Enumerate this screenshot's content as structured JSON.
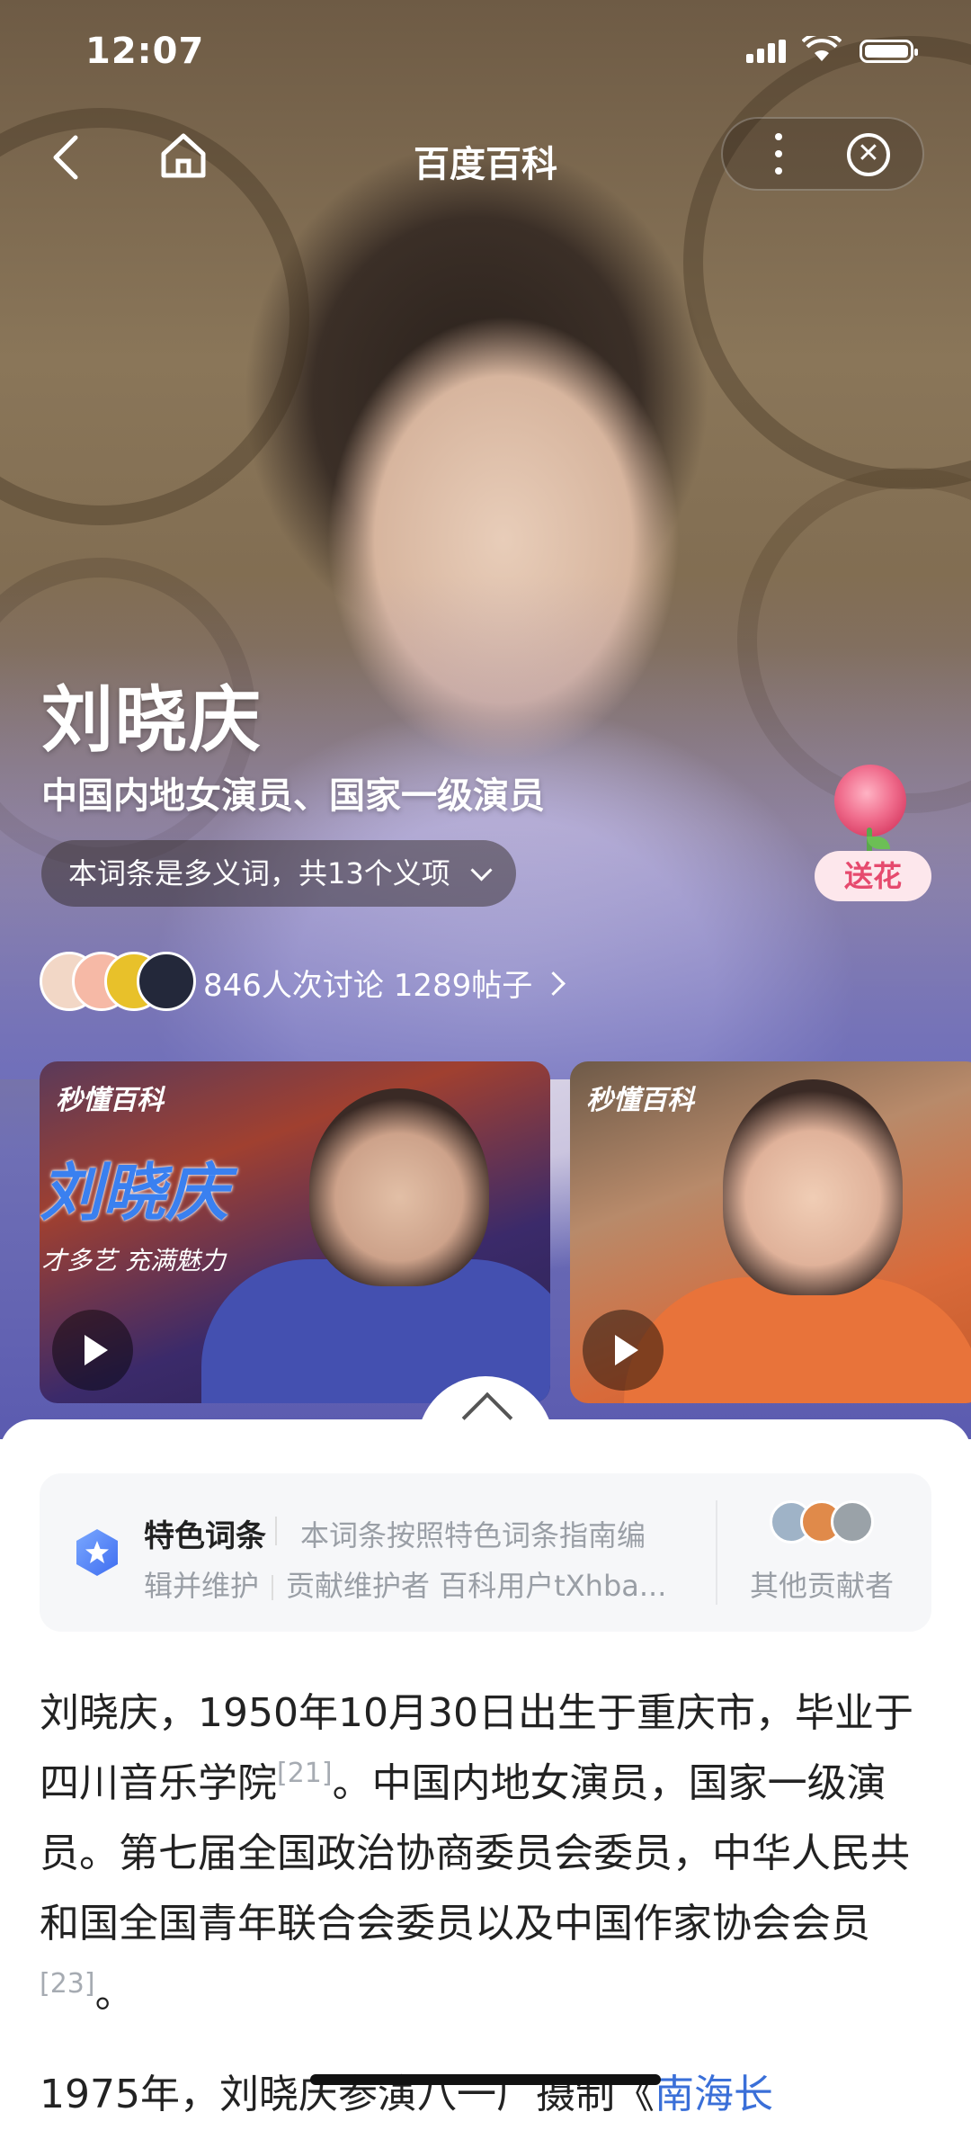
{
  "status_bar": {
    "time": "12:07"
  },
  "nav": {
    "title": "百度百科"
  },
  "person": {
    "name": "刘晓庆",
    "description": "中国内地女演员、国家一级演员",
    "polysemy_label": "本词条是多义词，共13个义项"
  },
  "flower": {
    "label": "送花"
  },
  "discussion": {
    "text": "846人次讨论  1289帖子"
  },
  "videos": [
    {
      "brand": "秒懂百科",
      "headline": "刘晓庆",
      "subtitle": "才多艺 充满魅力"
    },
    {
      "brand": "秒懂百科"
    }
  ],
  "feature": {
    "title": "特色词条",
    "line1": "本词条按照特色词条指南编",
    "line2_a": "辑并维护",
    "line2_b": "贡献维护者 百科用户tXhba...",
    "others": "其他贡献者"
  },
  "intro": {
    "p1_a": "刘晓庆，1950年10月30日出生于重庆市，毕业于四川音乐学院",
    "ref1": "[21]",
    "p1_b": "。中国内地女演员，国家一级演员。第七届全国政治协商委员会委员，中华人民共和国全国青年联合会委员以及中国作家协会会员",
    "ref2": "[23]",
    "p1_c": "。",
    "p2_a": "1975年，刘晓庆参演八一厂摄制《",
    "p2_link": "南海长"
  },
  "colors": {
    "link": "#3a6fd8",
    "flower_text": "#e64a6e",
    "muted": "#9a9fa6"
  }
}
